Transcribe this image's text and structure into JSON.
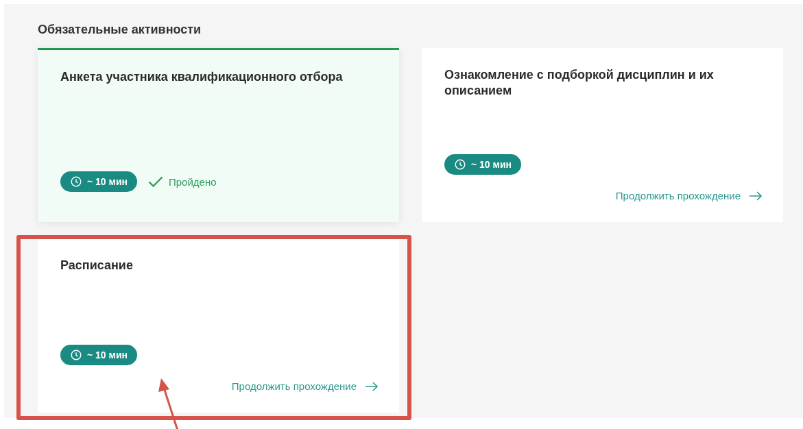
{
  "section": {
    "title": "Обязательные активности"
  },
  "cards": [
    {
      "title": "Анкета участника квалификационного отбора",
      "duration": "~ 10 мин",
      "completed": true,
      "status": "Пройдено",
      "highlighted": false
    },
    {
      "title": "Ознакомление с подборкой дисциплин и их описанием",
      "duration": "~ 10 мин",
      "completed": false,
      "action": "Продолжить прохождение",
      "highlighted": false
    },
    {
      "title": "Расписание",
      "duration": "~ 10 мин",
      "completed": false,
      "action": "Продолжить прохождение",
      "highlighted": true
    }
  ]
}
